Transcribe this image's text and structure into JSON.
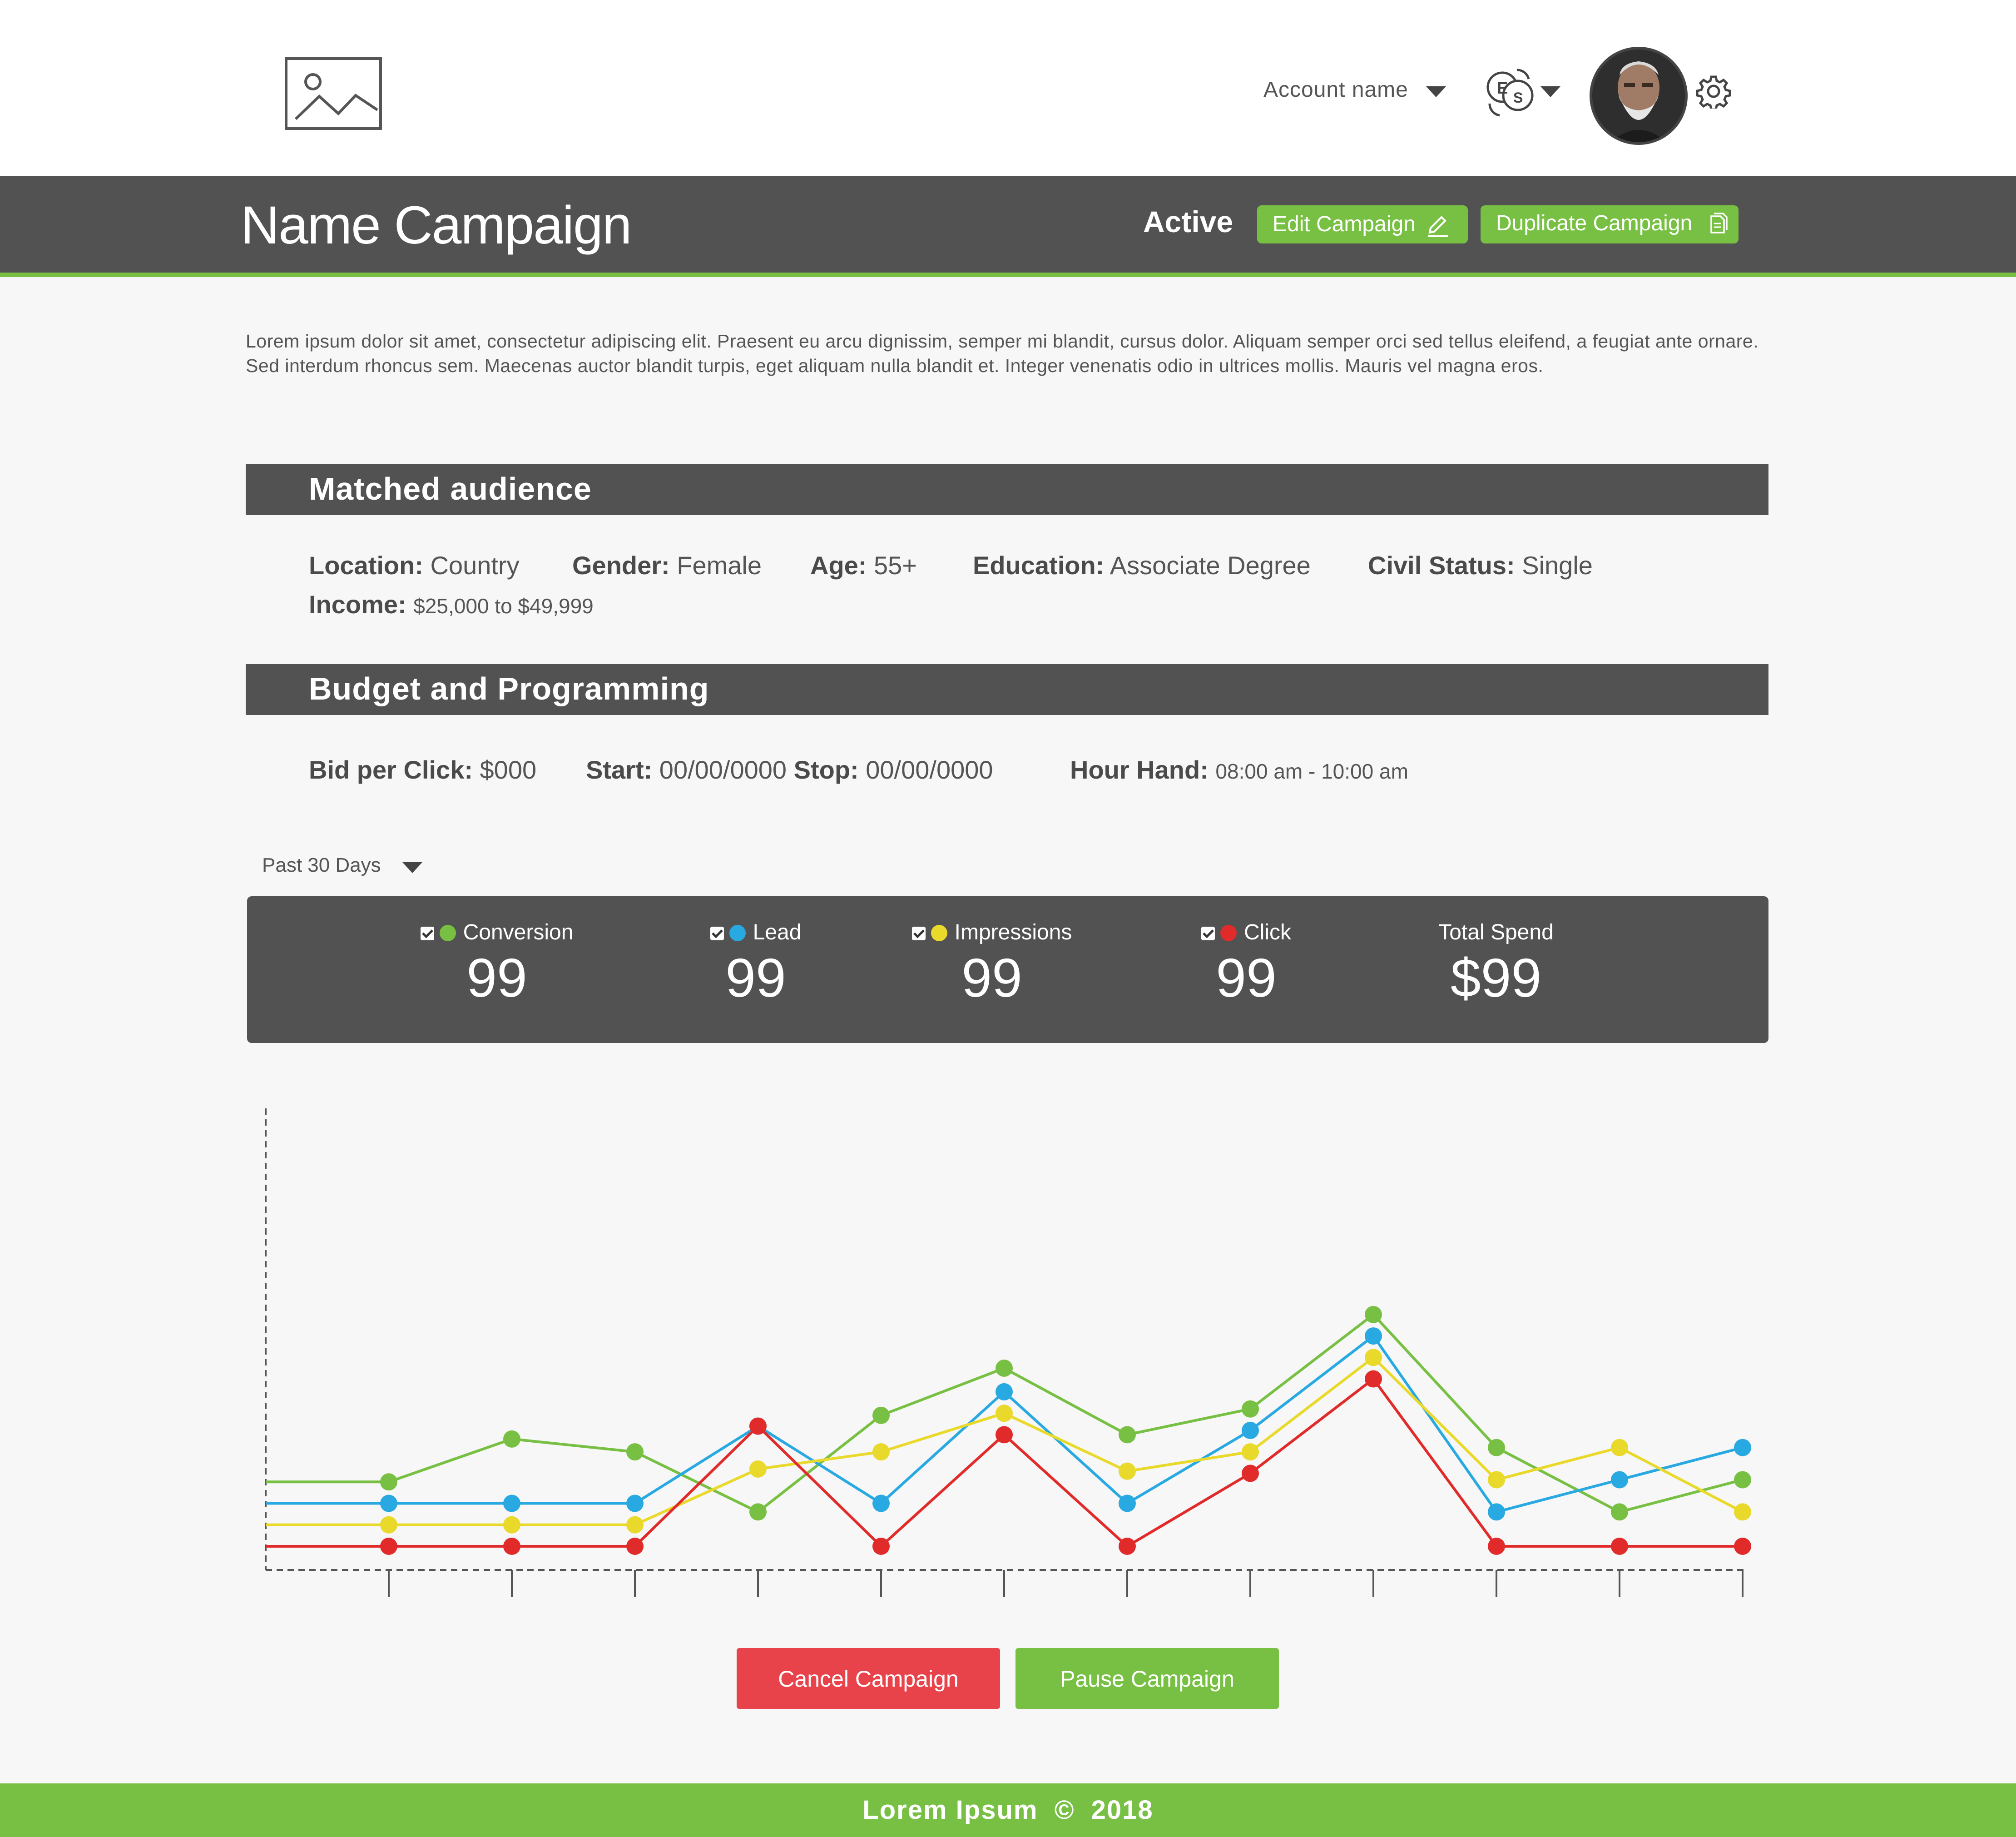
{
  "header": {
    "account_name": "Account name",
    "language_codes": [
      "E",
      "S"
    ]
  },
  "campaign": {
    "title": "Name Campaign",
    "status": "Active",
    "edit_label": "Edit Campaign",
    "duplicate_label": "Duplicate Campaign"
  },
  "description": "Lorem ipsum dolor sit amet, consectetur adipiscing elit. Praesent eu arcu dignissim, semper mi blandit, cursus dolor. Aliquam semper orci sed tellus eleifend, a feugiat ante ornare. Sed interdum rhoncus sem. Maecenas auctor blandit turpis, eget aliquam nulla blandit et. Integer venenatis odio in ultrices mollis. Mauris vel magna eros.",
  "audience": {
    "title": "Matched audience",
    "location_label": "Location:",
    "location": "Country",
    "gender_label": "Gender:",
    "gender": "Female",
    "age_label": "Age:",
    "age": "55+",
    "education_label": "Education:",
    "education": "Associate Degree",
    "civil_label": "Civil Status:",
    "civil": "Single",
    "income_label": "Income:",
    "income": "$25,000 to $49,999"
  },
  "budget": {
    "title": "Budget and Programming",
    "bid_label": "Bid per Click:",
    "bid": "$000",
    "start_label": "Start:",
    "start": "00/00/0000",
    "stop_label": "Stop:",
    "stop": "00/00/0000",
    "hour_label": "Hour Hand:",
    "hour": "08:00 am - 10:00 am"
  },
  "range_select": "Past 30 Days",
  "stats": {
    "conversion_label": "Conversion",
    "conversion": "99",
    "lead_label": "Lead",
    "lead": "99",
    "impressions_label": "Impressions",
    "impressions": "99",
    "click_label": "Click",
    "click": "99",
    "spend_label": "Total Spend",
    "spend": "$99"
  },
  "colors": {
    "conversion": "#78c043",
    "lead": "#29a9e1",
    "impressions": "#e9d92b",
    "click": "#e12b2b",
    "accent": "#78c043",
    "cancel": "#e8434a",
    "dark": "#525252"
  },
  "chart_data": {
    "type": "line",
    "title": "",
    "xlabel": "",
    "ylabel": "",
    "x": [
      0,
      1,
      2,
      3,
      4,
      5,
      6,
      7,
      8,
      9,
      10,
      11,
      12
    ],
    "ylim": [
      0,
      20
    ],
    "series": [
      {
        "name": "Conversion",
        "color": "#78c043",
        "values": [
          3,
          3,
          5,
          4.4,
          1.6,
          6.1,
          8.3,
          5.2,
          6.4,
          10.8,
          4.6,
          1.6,
          3.1
        ]
      },
      {
        "name": "Lead",
        "color": "#29a9e1",
        "values": [
          2,
          2,
          2,
          2,
          5.6,
          2,
          7.2,
          2,
          5.4,
          9.8,
          1.6,
          3.1,
          4.6
        ]
      },
      {
        "name": "Impressions",
        "color": "#e9d92b",
        "values": [
          1,
          1,
          1,
          1,
          3.6,
          4.4,
          6.2,
          3.5,
          4.4,
          8.8,
          3.1,
          4.6,
          1.6
        ]
      },
      {
        "name": "Click",
        "color": "#e12b2b",
        "values": [
          0,
          0,
          0,
          0,
          5.6,
          0,
          5.2,
          0,
          3.4,
          7.8,
          0,
          0,
          0
        ]
      }
    ]
  },
  "actions": {
    "cancel_label": "Cancel Campaign",
    "pause_label": "Pause Campaign"
  },
  "footer": {
    "text": "Lorem Ipsum  ©  2018"
  }
}
